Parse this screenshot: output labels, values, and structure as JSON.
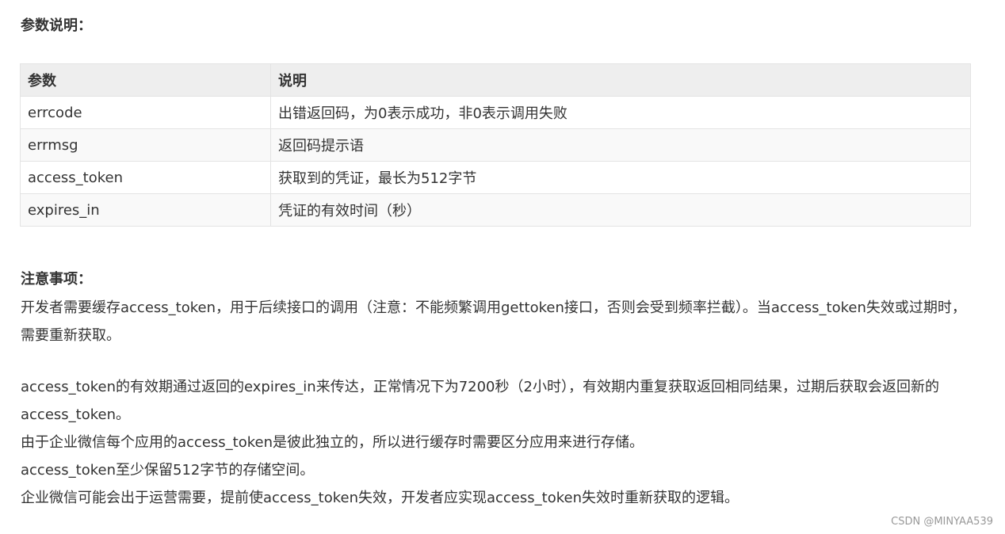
{
  "params_section": {
    "heading": "参数说明："
  },
  "params_table": {
    "headers": [
      "参数",
      "说明"
    ],
    "rows": [
      {
        "param": "errcode",
        "desc": "出错返回码，为0表示成功，非0表示调用失败"
      },
      {
        "param": "errmsg",
        "desc": "返回码提示语"
      },
      {
        "param": "access_token",
        "desc": "获取到的凭证，最长为512字节"
      },
      {
        "param": "expires_in",
        "desc": "凭证的有效时间（秒）"
      }
    ]
  },
  "notes_section": {
    "heading": "注意事项：",
    "paragraphs": [
      "开发者需要缓存access_token，用于后续接口的调用（注意：不能频繁调用gettoken接口，否则会受到频率拦截）。当access_token失效或过期时，需要重新获取。",
      "access_token的有效期通过返回的expires_in来传达，正常情况下为7200秒（2小时），有效期内重复获取返回相同结果，过期后获取会返回新的access_token。",
      "由于企业微信每个应用的access_token是彼此独立的，所以进行缓存时需要区分应用来进行存储。",
      "access_token至少保留512字节的存储空间。",
      "企业微信可能会出于运营需要，提前使access_token失效，开发者应实现access_token失效时重新获取的逻辑。"
    ]
  },
  "watermark": "CSDN @MINYAA539"
}
